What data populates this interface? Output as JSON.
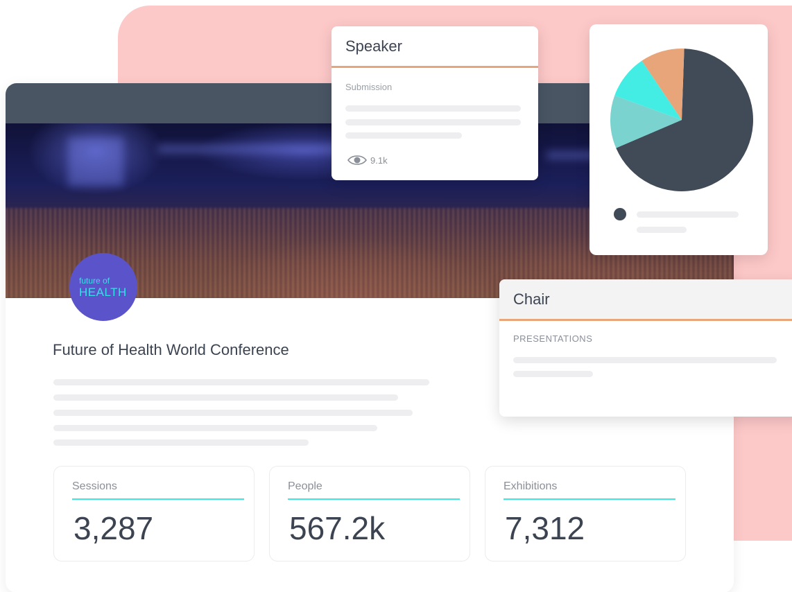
{
  "event": {
    "title": "Future of Health World Conference",
    "logo_small": "future of",
    "logo_big": "HEALTH"
  },
  "stats": [
    {
      "label": "Sessions",
      "value": "3,287"
    },
    {
      "label": "People",
      "value": "567.2k"
    },
    {
      "label": "Exhibitions",
      "value": "7,312"
    }
  ],
  "speaker_card": {
    "title": "Speaker",
    "subtitle": "Submission",
    "views": "9.1k",
    "icon": "eye-icon"
  },
  "chair_card": {
    "title": "Chair",
    "subtitle": "PRESENTATIONS"
  },
  "chart_data": {
    "type": "pie",
    "values": [
      68,
      12,
      10,
      10
    ],
    "colors": [
      "#414a57",
      "#7bd3cf",
      "#44ede3",
      "#e9a57a"
    ]
  },
  "colors": {
    "accent_orange": "#e9a57a",
    "accent_cyan": "#3fe6e0",
    "header_dark": "#4a5564",
    "background_pink": "#fdc8c8",
    "logo_purple": "#5b53c9"
  }
}
